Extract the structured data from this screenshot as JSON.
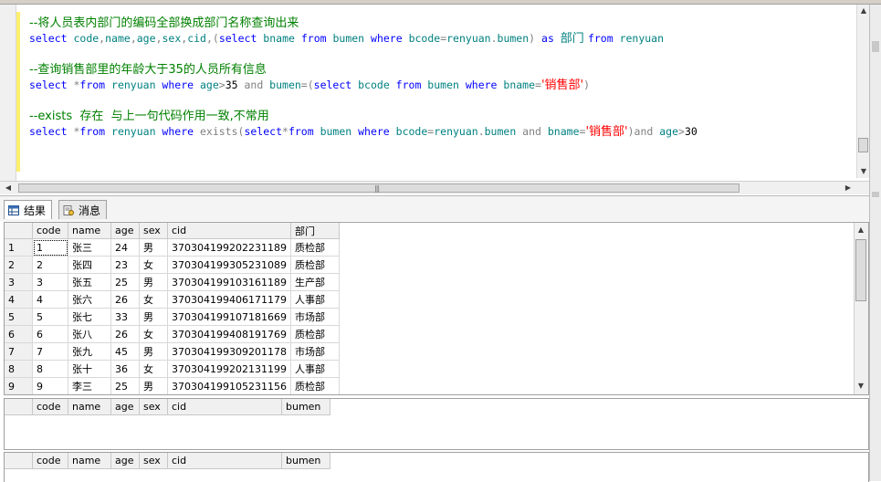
{
  "editor": {
    "lines": [
      [
        {
          "t": "--将人员表内部门的编码全部换成部门名称查询出来",
          "c": "cmt cn"
        }
      ],
      [
        {
          "t": "select ",
          "c": "kw"
        },
        {
          "t": "code",
          "c": "id"
        },
        {
          "t": ",",
          "c": "op"
        },
        {
          "t": "name",
          "c": "id"
        },
        {
          "t": ",",
          "c": "op"
        },
        {
          "t": "age",
          "c": "id"
        },
        {
          "t": ",",
          "c": "op"
        },
        {
          "t": "sex",
          "c": "id"
        },
        {
          "t": ",",
          "c": "op"
        },
        {
          "t": "cid",
          "c": "id"
        },
        {
          "t": ",(",
          "c": "op"
        },
        {
          "t": "select ",
          "c": "kw"
        },
        {
          "t": "bname ",
          "c": "id"
        },
        {
          "t": "from ",
          "c": "kw"
        },
        {
          "t": "bumen ",
          "c": "id"
        },
        {
          "t": "where ",
          "c": "kw"
        },
        {
          "t": "bcode",
          "c": "id"
        },
        {
          "t": "=",
          "c": "op"
        },
        {
          "t": "renyuan",
          "c": "id"
        },
        {
          "t": ".",
          "c": "op"
        },
        {
          "t": "bumen",
          "c": "id"
        },
        {
          "t": ") ",
          "c": "op"
        },
        {
          "t": "as ",
          "c": "kw"
        },
        {
          "t": "部门 ",
          "c": "id cn"
        },
        {
          "t": "from ",
          "c": "kw"
        },
        {
          "t": "renyuan",
          "c": "id"
        }
      ],
      [],
      [
        {
          "t": "--查询销售部里的年龄大于35的人员所有信息",
          "c": "cmt cn"
        }
      ],
      [
        {
          "t": "select ",
          "c": "kw"
        },
        {
          "t": "*",
          "c": "op"
        },
        {
          "t": "from ",
          "c": "kw"
        },
        {
          "t": "renyuan ",
          "c": "id"
        },
        {
          "t": "where ",
          "c": "kw"
        },
        {
          "t": "age",
          "c": "id"
        },
        {
          "t": ">",
          "c": "op"
        },
        {
          "t": "35 ",
          "c": ""
        },
        {
          "t": "and ",
          "c": "op"
        },
        {
          "t": "bumen",
          "c": "id"
        },
        {
          "t": "=(",
          "c": "op"
        },
        {
          "t": "select ",
          "c": "kw"
        },
        {
          "t": "bcode ",
          "c": "id"
        },
        {
          "t": "from ",
          "c": "kw"
        },
        {
          "t": "bumen ",
          "c": "id"
        },
        {
          "t": "where ",
          "c": "kw"
        },
        {
          "t": "bname",
          "c": "id"
        },
        {
          "t": "=",
          "c": "op"
        },
        {
          "t": "'销售部'",
          "c": "str cn"
        },
        {
          "t": ")",
          "c": "op"
        }
      ],
      [],
      [
        {
          "t": "--exists  存在  与上一句代码作用一致,不常用",
          "c": "cmt cn"
        }
      ],
      [
        {
          "t": "select ",
          "c": "kw"
        },
        {
          "t": "*",
          "c": "op"
        },
        {
          "t": "from ",
          "c": "kw"
        },
        {
          "t": "renyuan ",
          "c": "id"
        },
        {
          "t": "where ",
          "c": "kw"
        },
        {
          "t": "exists",
          "c": "op"
        },
        {
          "t": "(",
          "c": "op"
        },
        {
          "t": "select",
          "c": "kw"
        },
        {
          "t": "*",
          "c": "op"
        },
        {
          "t": "from ",
          "c": "kw"
        },
        {
          "t": "bumen ",
          "c": "id"
        },
        {
          "t": "where ",
          "c": "kw"
        },
        {
          "t": "bcode",
          "c": "id"
        },
        {
          "t": "=",
          "c": "op"
        },
        {
          "t": "renyuan",
          "c": "id"
        },
        {
          "t": ".",
          "c": "op"
        },
        {
          "t": "bumen ",
          "c": "id"
        },
        {
          "t": "and ",
          "c": "op"
        },
        {
          "t": "bname",
          "c": "id"
        },
        {
          "t": "=",
          "c": "op"
        },
        {
          "t": "'销售部'",
          "c": "str cn"
        },
        {
          "t": ")",
          "c": "op"
        },
        {
          "t": "and ",
          "c": "op"
        },
        {
          "t": "age",
          "c": "id"
        },
        {
          "t": ">",
          "c": "op"
        },
        {
          "t": "30",
          "c": ""
        }
      ]
    ]
  },
  "tabs": {
    "results": "结果",
    "messages": "消息"
  },
  "grid1": {
    "columns": [
      "",
      "code",
      "name",
      "age",
      "sex",
      "cid",
      "部门"
    ],
    "rows": [
      [
        "1",
        "1",
        "张三",
        "24",
        "男",
        "370304199202231189",
        "质检部"
      ],
      [
        "2",
        "2",
        "张四",
        "23",
        "女",
        "370304199305231089",
        "质检部"
      ],
      [
        "3",
        "3",
        "张五",
        "25",
        "男",
        "370304199103161189",
        "生产部"
      ],
      [
        "4",
        "4",
        "张六",
        "26",
        "女",
        "370304199406171179",
        "人事部"
      ],
      [
        "5",
        "5",
        "张七",
        "33",
        "男",
        "370304199107181669",
        "市场部"
      ],
      [
        "6",
        "6",
        "张八",
        "26",
        "女",
        "370304199408191769",
        "质检部"
      ],
      [
        "7",
        "7",
        "张九",
        "45",
        "男",
        "370304199309201178",
        "市场部"
      ],
      [
        "8",
        "8",
        "张十",
        "36",
        "女",
        "370304199202131199",
        "人事部"
      ],
      [
        "9",
        "9",
        "李三",
        "25",
        "男",
        "370304199105231156",
        "质检部"
      ]
    ]
  },
  "grid2": {
    "columns": [
      "",
      "code",
      "name",
      "age",
      "sex",
      "cid",
      "bumen"
    ]
  },
  "grid3": {
    "columns": [
      "",
      "code",
      "name",
      "age",
      "sex",
      "cid",
      "bumen"
    ]
  },
  "colors": {
    "keyword": "#0000ff",
    "identifier": "#008080",
    "comment": "#008000",
    "string": "#ff0000",
    "operator": "#808080"
  }
}
